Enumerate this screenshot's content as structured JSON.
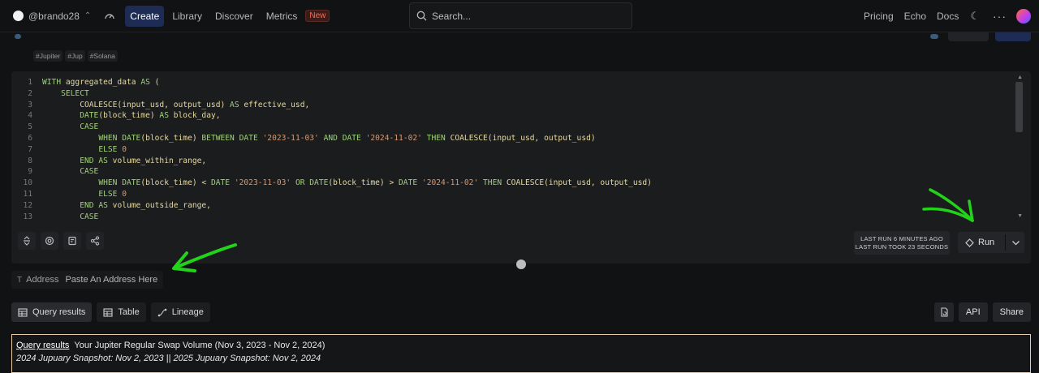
{
  "topbar": {
    "username": "@brando28",
    "nav": [
      {
        "label": "Create",
        "active": true
      },
      {
        "label": "Library"
      },
      {
        "label": "Discover"
      },
      {
        "label": "Metrics"
      }
    ],
    "new_badge": "New",
    "search_placeholder": "Search...",
    "right_links": [
      "Pricing",
      "Echo",
      "Docs"
    ]
  },
  "tags": [
    "#Jupiter",
    "#Jup",
    "#Solana"
  ],
  "editor": {
    "lines": [
      "1",
      "2",
      "3",
      "4",
      "5",
      "6",
      "7",
      "8",
      "9",
      "10",
      "11",
      "12",
      "13"
    ],
    "last_run_1": "LAST RUN 6 MINUTES AGO",
    "last_run_2": "LAST RUN TOOK 23 SECONDS",
    "run_label": "Run"
  },
  "params": {
    "address_label": "Address",
    "address_placeholder": "Paste An Address Here"
  },
  "tabs": {
    "query_results": "Query results",
    "table": "Table",
    "lineage": "Lineage",
    "api": "API",
    "share": "Share"
  },
  "results": {
    "link": "Query results",
    "title": "Your Jupiter Regular Swap Volume (Nov 3, 2023 - Nov 2, 2024)",
    "subtitle": "2024 Jupuary Snapshot: Nov 2, 2023 || 2025 Jupuary Snapshot: Nov 2, 2024"
  },
  "colors": {
    "accent": "#1d2b55",
    "annotation_arrow": "#22d31a",
    "new_badge": "#ff6a55"
  }
}
